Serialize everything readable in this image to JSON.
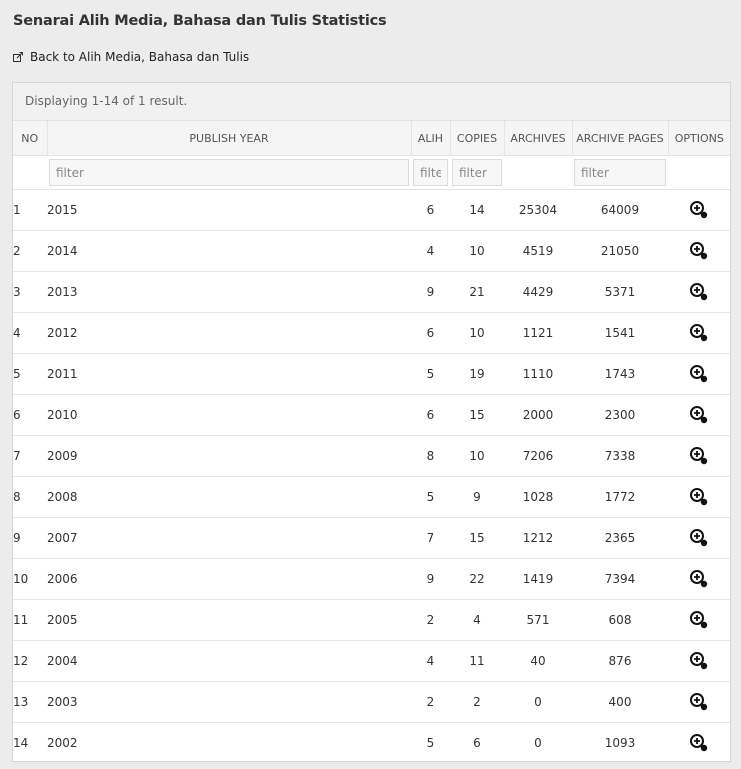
{
  "page": {
    "title": "Senarai Alih Media, Bahasa dan Tulis Statistics",
    "back_link": "Back to Alih Media, Bahasa dan Tulis"
  },
  "grid": {
    "summary": "Displaying 1-14 of 1 result.",
    "columns": [
      "NO",
      "PUBLISH YEAR",
      "ALIH",
      "COPIES",
      "ARCHIVES",
      "ARCHIVE PAGES",
      "OPTIONS"
    ],
    "filter_placeholder": "filter",
    "rows": [
      {
        "no": "1",
        "year": "2015",
        "alih": "6",
        "copies": "14",
        "archives": "25304",
        "pages": "64009"
      },
      {
        "no": "2",
        "year": "2014",
        "alih": "4",
        "copies": "10",
        "archives": "4519",
        "pages": "21050"
      },
      {
        "no": "3",
        "year": "2013",
        "alih": "9",
        "copies": "21",
        "archives": "4429",
        "pages": "5371"
      },
      {
        "no": "4",
        "year": "2012",
        "alih": "6",
        "copies": "10",
        "archives": "1121",
        "pages": "1541"
      },
      {
        "no": "5",
        "year": "2011",
        "alih": "5",
        "copies": "19",
        "archives": "1110",
        "pages": "1743"
      },
      {
        "no": "6",
        "year": "2010",
        "alih": "6",
        "copies": "15",
        "archives": "2000",
        "pages": "2300"
      },
      {
        "no": "7",
        "year": "2009",
        "alih": "8",
        "copies": "10",
        "archives": "7206",
        "pages": "7338"
      },
      {
        "no": "8",
        "year": "2008",
        "alih": "5",
        "copies": "9",
        "archives": "1028",
        "pages": "1772"
      },
      {
        "no": "9",
        "year": "2007",
        "alih": "7",
        "copies": "15",
        "archives": "1212",
        "pages": "2365"
      },
      {
        "no": "10",
        "year": "2006",
        "alih": "9",
        "copies": "22",
        "archives": "1419",
        "pages": "7394"
      },
      {
        "no": "11",
        "year": "2005",
        "alih": "2",
        "copies": "4",
        "archives": "571",
        "pages": "608"
      },
      {
        "no": "12",
        "year": "2004",
        "alih": "4",
        "copies": "11",
        "archives": "40",
        "pages": "876"
      },
      {
        "no": "13",
        "year": "2003",
        "alih": "2",
        "copies": "2",
        "archives": "0",
        "pages": "400"
      },
      {
        "no": "14",
        "year": "2002",
        "alih": "5",
        "copies": "6",
        "archives": "0",
        "pages": "1093"
      }
    ],
    "row_action_icon": "zoom-in-icon"
  },
  "icons": {
    "back": "external-link-icon",
    "view": "zoom-in-icon"
  },
  "colors": {
    "background": "#ececec",
    "panel": "#ffffff",
    "header_bg": "#f5f5f5",
    "icon": "#111111"
  }
}
